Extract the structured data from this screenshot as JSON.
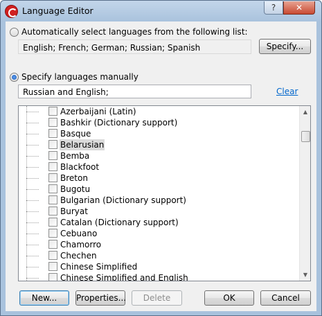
{
  "window": {
    "title": "Language Editor",
    "help_label": "?",
    "close_label": "✕"
  },
  "auto_option": {
    "label": "Automatically select languages from the following list:",
    "selected": false,
    "languages": "English; French; German; Russian; Spanish",
    "specify_button": "Specify..."
  },
  "manual_option": {
    "label": "Specify languages manually",
    "selected": true,
    "value": "Russian and English;",
    "clear_link": "Clear"
  },
  "language_list": {
    "items": [
      {
        "label": "Azerbaijani (Latin)",
        "checked": false,
        "selected": false
      },
      {
        "label": "Bashkir (Dictionary support)",
        "checked": false,
        "selected": false
      },
      {
        "label": "Basque",
        "checked": false,
        "selected": false
      },
      {
        "label": "Belarusian",
        "checked": false,
        "selected": true
      },
      {
        "label": "Bemba",
        "checked": false,
        "selected": false
      },
      {
        "label": "Blackfoot",
        "checked": false,
        "selected": false
      },
      {
        "label": "Breton",
        "checked": false,
        "selected": false
      },
      {
        "label": "Bugotu",
        "checked": false,
        "selected": false
      },
      {
        "label": "Bulgarian (Dictionary support)",
        "checked": false,
        "selected": false
      },
      {
        "label": "Buryat",
        "checked": false,
        "selected": false
      },
      {
        "label": "Catalan (Dictionary support)",
        "checked": false,
        "selected": false
      },
      {
        "label": "Cebuano",
        "checked": false,
        "selected": false
      },
      {
        "label": "Chamorro",
        "checked": false,
        "selected": false
      },
      {
        "label": "Chechen",
        "checked": false,
        "selected": false
      },
      {
        "label": "Chinese Simplified",
        "checked": false,
        "selected": false
      },
      {
        "label": "Chinese Simplified and English",
        "checked": false,
        "selected": false
      }
    ],
    "scroll_up_icon": "up-arrow",
    "scroll_down_icon": "down-arrow"
  },
  "buttons": {
    "new": "New...",
    "properties": "Properties...",
    "delete": "Delete",
    "ok": "OK",
    "cancel": "Cancel"
  }
}
